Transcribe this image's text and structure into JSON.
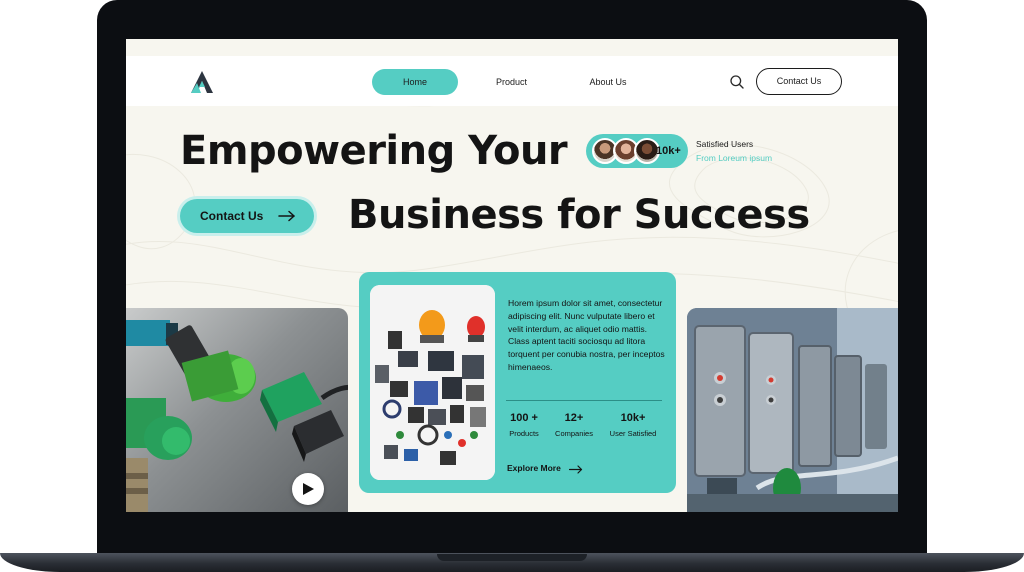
{
  "colors": {
    "accent": "#55cdc3",
    "text": "#141414",
    "background": "#f7f6ef",
    "device": "#0c0e12"
  },
  "icons": {
    "logo": "logo-icon",
    "search": "search-icon",
    "arrow": "arrow-right-icon",
    "play": "play-icon"
  },
  "nav": {
    "items": [
      {
        "label": "Home",
        "active": true
      },
      {
        "label": "Product",
        "active": false
      },
      {
        "label": "About Us",
        "active": false
      }
    ],
    "contact_label": "Contact Us"
  },
  "hero": {
    "line1": "Empowering Your",
    "line2": "Business for Success",
    "cta_label": "Contact Us",
    "users": {
      "count": "10k+",
      "title": "Satisfied Users",
      "subtitle": "From Loreum ipsum"
    }
  },
  "card": {
    "description": "Horem ipsum dolor sit amet, consectetur adipiscing elit. Nunc vulputate libero et velit interdum, ac aliquet odio mattis. Class aptent taciti sociosqu ad litora torquent per conubia nostra, per inceptos himenaeos.",
    "stats": [
      {
        "value": "100 +",
        "label": "Products"
      },
      {
        "value": "12+",
        "label": "Companies"
      },
      {
        "value": "10k+",
        "label": "User Satisfied"
      }
    ],
    "explore_label": "Explore More"
  }
}
